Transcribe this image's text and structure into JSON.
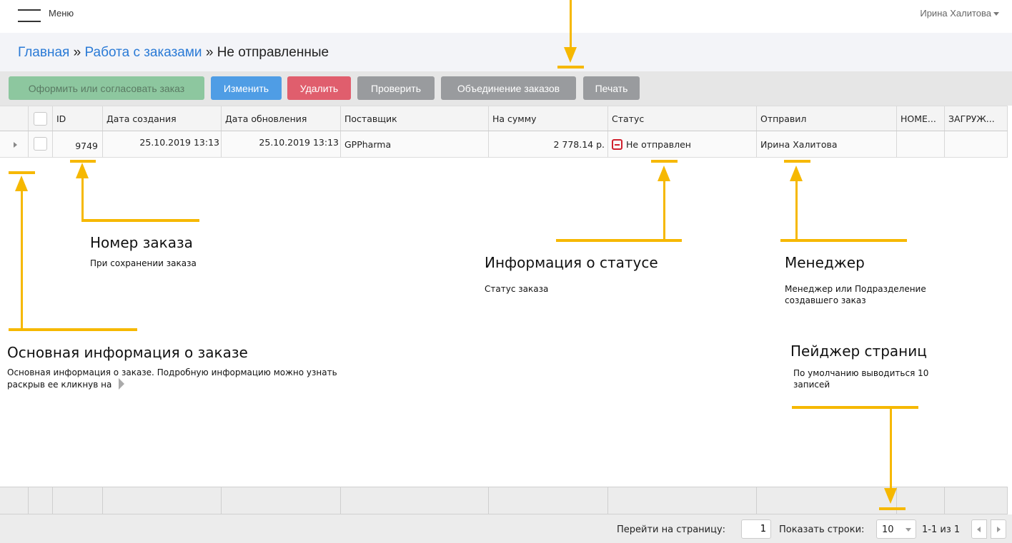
{
  "topbar": {
    "menu_label": "Меню",
    "user_name": "Ирина Халитова"
  },
  "breadcrumb": {
    "home": "Главная",
    "separator": "»",
    "orders": "Работа с заказами",
    "current": "Не отправленные"
  },
  "toolbar": {
    "place_order": "Оформить или согласовать заказ",
    "edit": "Изменить",
    "delete": "Удалить",
    "check": "Проверить",
    "merge": "Объединение заказов",
    "print": "Печать"
  },
  "grid": {
    "columns": [
      "ID",
      "Дата создания",
      "Дата обновления",
      "Поставщик",
      "На сумму",
      "Статус",
      "Отправил",
      "НОМЕ...",
      "ЗАГРУЖ..."
    ],
    "rows": [
      {
        "id": "9749",
        "created": "25.10.2019 13:13",
        "updated": "25.10.2019 13:13",
        "supplier": "GPPharma",
        "amount": "2 778.14 р.",
        "status": "Не отправлен",
        "sender": "Ирина Халитова",
        "number": "",
        "uploaded": ""
      }
    ]
  },
  "pager": {
    "goto_label": "Перейти на страницу:",
    "page": "1",
    "rows_label": "Показать строки:",
    "rows_value": "10",
    "info": "1-1 из 1"
  },
  "annotations": {
    "order_number": {
      "title": "Номер заказа",
      "desc": "При сохранении заказа"
    },
    "status_info": {
      "title": "Информация о статусе",
      "desc": "Статус заказа"
    },
    "manager": {
      "title": "Менеджер",
      "desc": "Менеджер или Подразделение создавшего заказ"
    },
    "main_info": {
      "title": "Основная информация о заказе",
      "desc": "Основная информация о заказе. Подробную информацию можно узнать раскрыв ее кликнув на"
    },
    "pager": {
      "title": "Пейджер страниц",
      "desc": "По умолчанию выводиться 10 записей"
    }
  },
  "colors": {
    "annotation": "#f6b800",
    "link": "#2a7ad6",
    "btn_green": "#8dc79f",
    "btn_blue": "#4f9de5",
    "btn_red": "#e05e6d",
    "btn_gray": "#999b9e",
    "status_red": "#d0202e"
  }
}
